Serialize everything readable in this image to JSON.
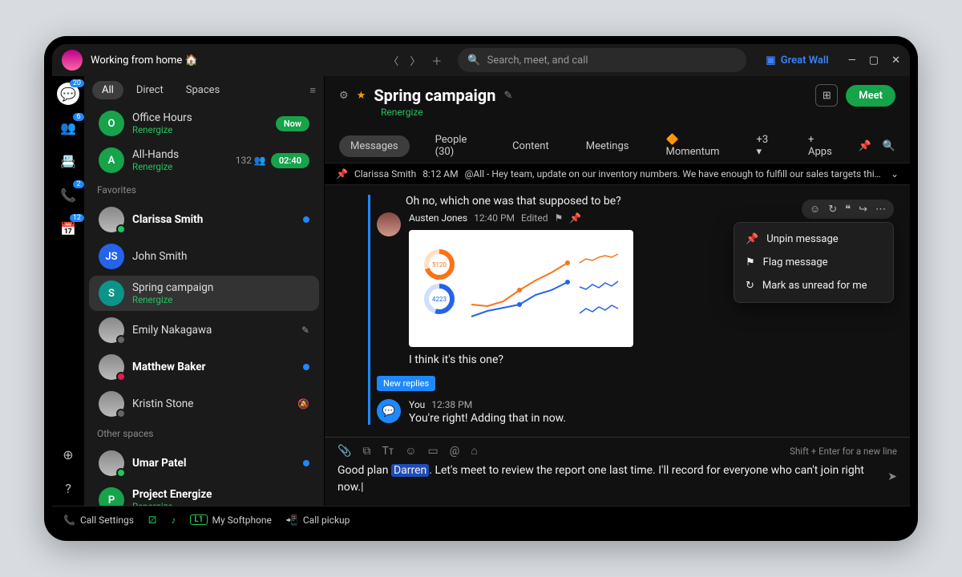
{
  "topbar": {
    "status": "Working from home 🏠",
    "search_placeholder": "Search, meet, and call",
    "org": "Great Wall"
  },
  "rail": {
    "items": [
      {
        "name": "chat-icon",
        "badge": "20",
        "active": true
      },
      {
        "name": "teams-icon",
        "badge": "6"
      },
      {
        "name": "contacts-icon",
        "badge": ""
      },
      {
        "name": "calls-icon",
        "badge": "2"
      },
      {
        "name": "calendar-icon",
        "badge": "12"
      }
    ]
  },
  "side": {
    "tabs": [
      "All",
      "Direct",
      "Spaces"
    ],
    "active_tab": 0,
    "groups": [
      {
        "label": "",
        "items": [
          {
            "avatar": "O",
            "color": "green",
            "name": "Office Hours",
            "sub": "Renergize",
            "right_kind": "pill",
            "right": "Now"
          },
          {
            "avatar": "A",
            "color": "green",
            "name": "All-Hands",
            "sub": "Renergize",
            "right_kind": "time",
            "right": "02:40",
            "extra": "132"
          }
        ]
      },
      {
        "label": "Favorites",
        "items": [
          {
            "avatar": "img",
            "name": "Clarissa Smith",
            "bold": true,
            "dot": true,
            "presence": "active"
          },
          {
            "avatar": "JS",
            "color": "blue",
            "name": "John Smith"
          },
          {
            "avatar": "S",
            "color": "teal",
            "name": "Spring campaign",
            "sub": "Renergize",
            "active": true
          },
          {
            "avatar": "img",
            "name": "Emily Nakagawa",
            "right_kind": "icon",
            "right": "✎",
            "presence": "away"
          },
          {
            "avatar": "img",
            "name": "Matthew Baker",
            "bold": true,
            "dot": true,
            "presence": "dnd"
          },
          {
            "avatar": "img",
            "name": "Kristin Stone",
            "right_kind": "icon",
            "right": "🔕",
            "presence": "away"
          }
        ]
      },
      {
        "label": "Other spaces",
        "items": [
          {
            "avatar": "img",
            "name": "Umar Patel",
            "bold": true,
            "dot": true,
            "presence": "active"
          },
          {
            "avatar": "P",
            "color": "green",
            "name": "Project Energize",
            "bold": true,
            "sub": "Renergize"
          }
        ]
      }
    ]
  },
  "space": {
    "title": "Spring campaign",
    "sub": "Renergize",
    "meet": "Meet",
    "tabs": [
      "Messages",
      "People (30)",
      "Content",
      "Meetings",
      "🔶 Momentum",
      "+3 ▾",
      "+ Apps"
    ],
    "active_tab": 0
  },
  "pinned": {
    "author": "Clarissa Smith",
    "time": "8:12 AM",
    "text": "@All - Hey team, update on our inventory numbers. We have enough to fulfill our sales targets this mon…"
  },
  "convo": {
    "reply_context": "Oh no, which one was that supposed to be?",
    "msg1": {
      "author": "Austen Jones",
      "time": "12:40 PM",
      "edited": "Edited",
      "text": "I think it's this one?"
    },
    "new_replies": "New replies",
    "msg2": {
      "author": "You",
      "time": "12:38 PM",
      "text": "You're right! Adding that in now."
    }
  },
  "react_bar": [
    "☺",
    "↻",
    "❝",
    "↪",
    "⋯"
  ],
  "ctx_menu": [
    {
      "icon": "📌",
      "label": "Unpin message"
    },
    {
      "icon": "⚑",
      "label": "Flag message"
    },
    {
      "icon": "↻",
      "label": "Mark as unread for me"
    }
  ],
  "composer": {
    "hint": "Shift + Enter for a new line",
    "pre": "Good plan ",
    "mention": "Darren",
    "post": ". Let's meet to review the report one last time. I'll record for everyone who can't join right now.|"
  },
  "bottombar": {
    "call_settings": "Call Settings",
    "softphone": "My Softphone",
    "l1": "L1",
    "pickup": "Call pickup"
  },
  "chart_data": {
    "type": "dashboard-thumbnail",
    "note": "values estimated from small embedded chart card",
    "donuts": [
      {
        "label": "5120",
        "color": "#f97316",
        "pct": 70
      },
      {
        "label": "4223",
        "color": "#2563eb",
        "pct": 55
      }
    ],
    "line_main": {
      "x": [
        1,
        2,
        3,
        4,
        5,
        6,
        7
      ],
      "series": [
        {
          "name": "orange",
          "color": "#f97316",
          "values": [
            20,
            18,
            22,
            30,
            38,
            45,
            52
          ]
        },
        {
          "name": "blue",
          "color": "#2563eb",
          "values": [
            10,
            15,
            18,
            20,
            28,
            32,
            40
          ]
        }
      ]
    },
    "sparklines": [
      {
        "color": "#f97316",
        "values": [
          3,
          5,
          4,
          6,
          7,
          6,
          8
        ]
      },
      {
        "color": "#2563eb",
        "values": [
          4,
          3,
          5,
          4,
          6,
          5,
          7
        ]
      },
      {
        "color": "#2563eb",
        "values": [
          2,
          4,
          3,
          5,
          4,
          6,
          5
        ]
      }
    ]
  }
}
